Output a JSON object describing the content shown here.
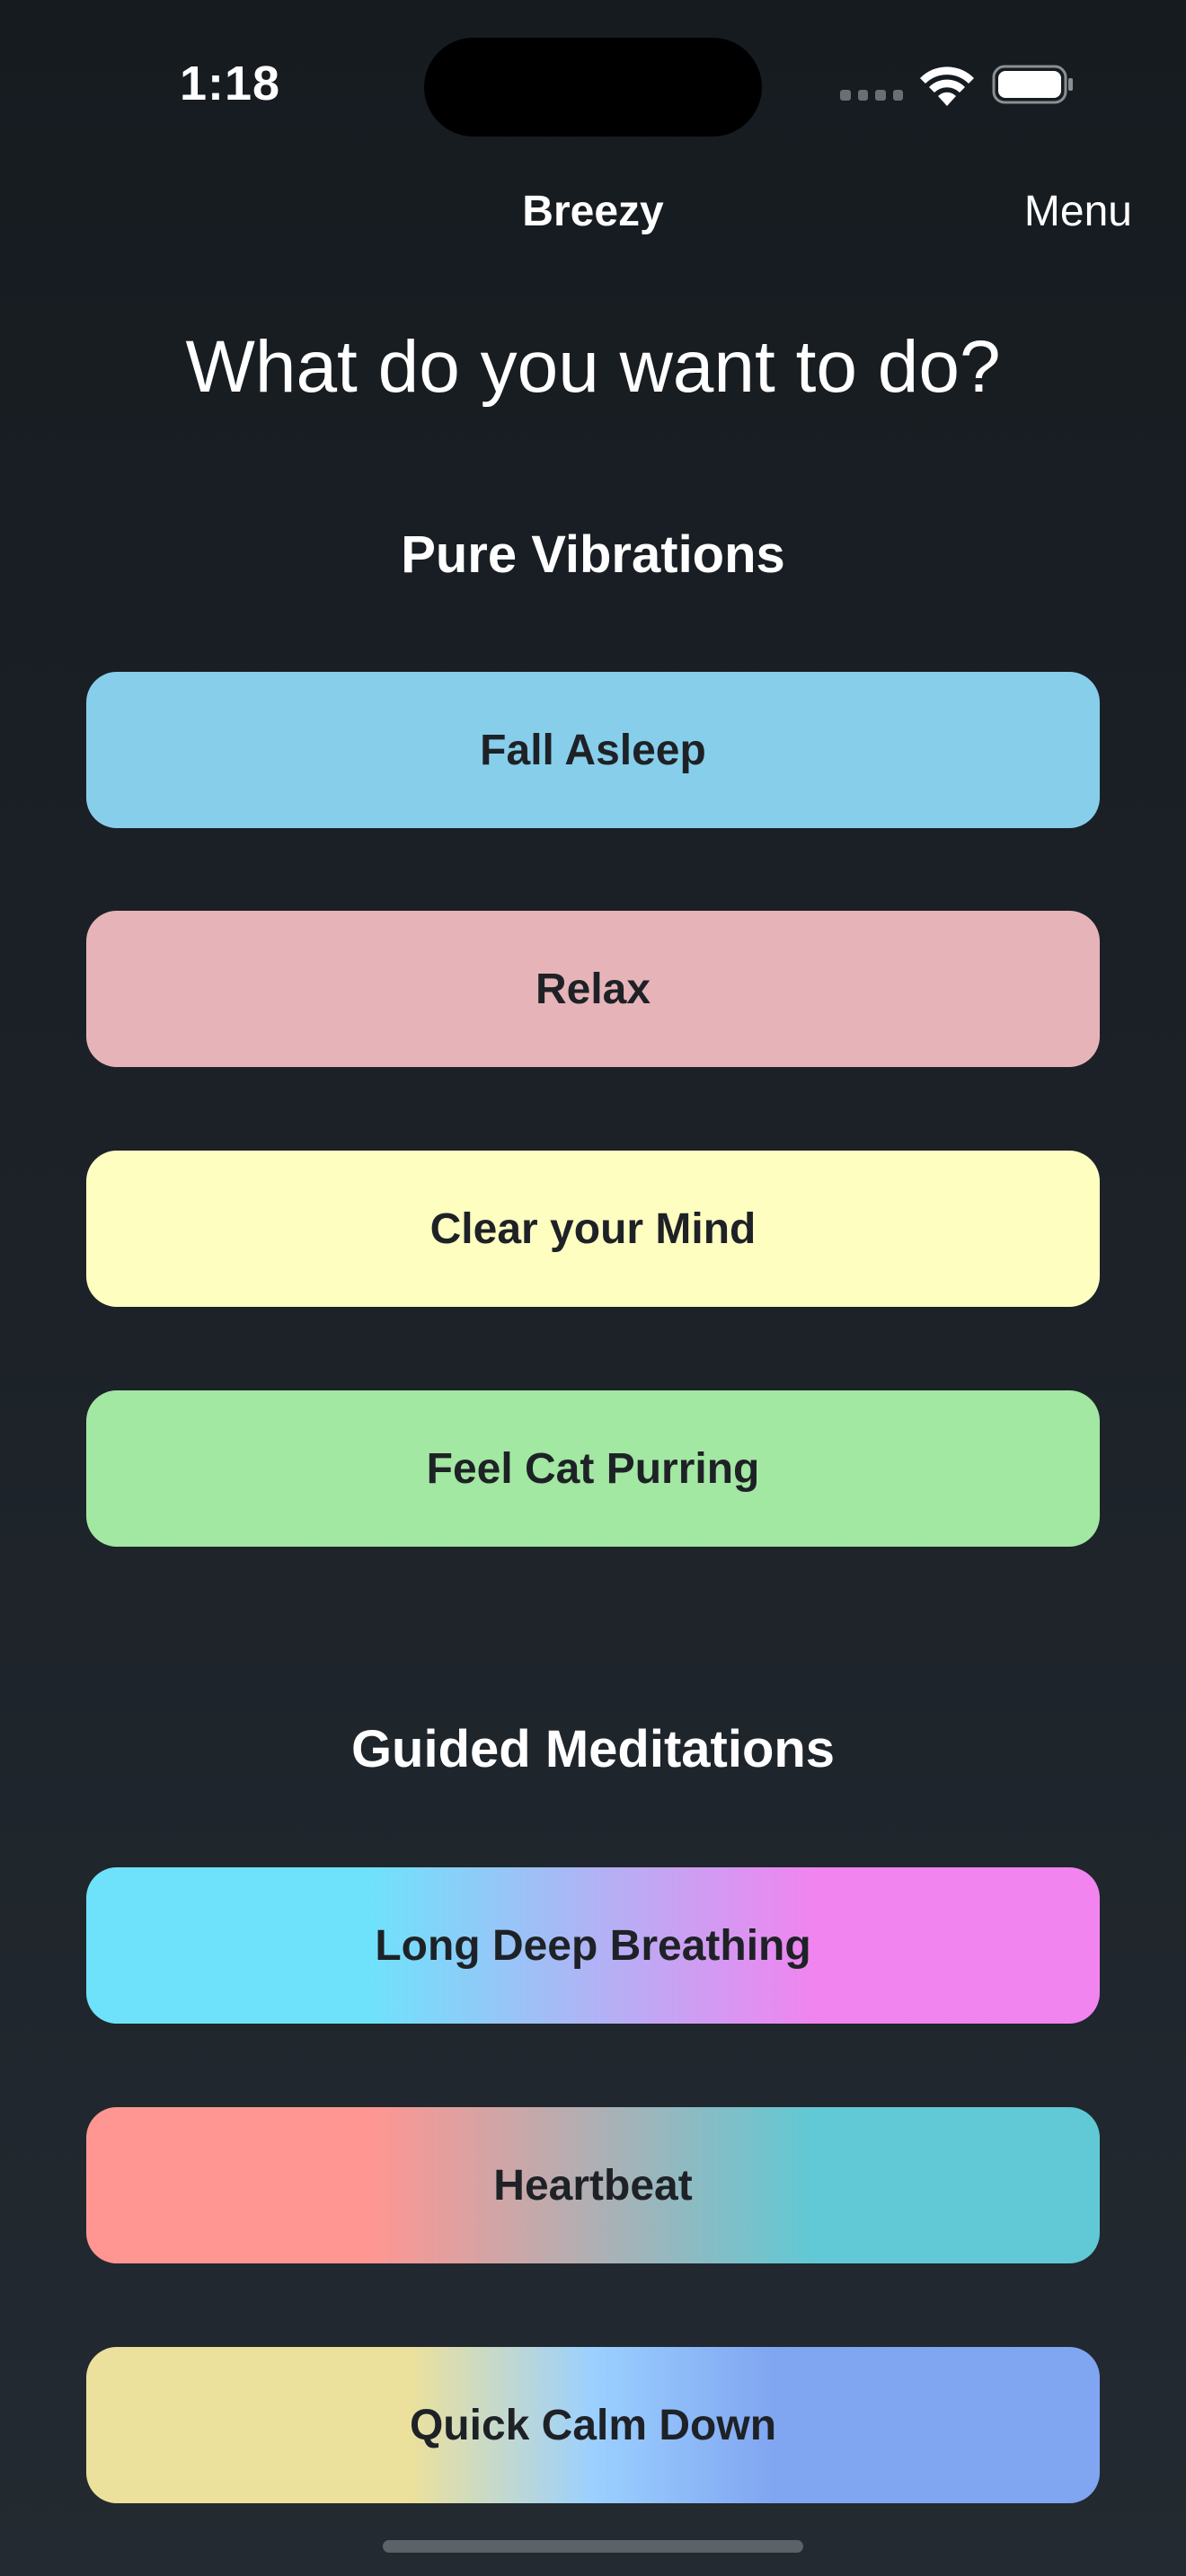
{
  "status_bar": {
    "time": "1:18"
  },
  "nav": {
    "title": "Breezy",
    "menu_label": "Menu"
  },
  "page_title": "What do you want to do?",
  "sections": [
    {
      "title": "Pure Vibrations",
      "items": [
        {
          "label": "Fall Asleep",
          "colors": [
            "#87ceeb"
          ]
        },
        {
          "label": "Relax",
          "colors": [
            "#e6b4b8"
          ]
        },
        {
          "label": "Clear your Mind",
          "colors": [
            "#fffec1"
          ]
        },
        {
          "label": "Feel Cat Purring",
          "colors": [
            "#a2e7a2"
          ]
        }
      ]
    },
    {
      "title": "Guided Meditations",
      "items": [
        {
          "label": "Long Deep Breathing",
          "colors": [
            "#6fe2fb",
            "#f184ef"
          ]
        },
        {
          "label": "Heartbeat",
          "colors": [
            "#ff9692",
            "#60c9d5"
          ]
        },
        {
          "label": "Quick Calm Down",
          "colors": [
            "#ebe19d",
            "#9bd0ff",
            "#80a5f1"
          ]
        }
      ]
    }
  ]
}
